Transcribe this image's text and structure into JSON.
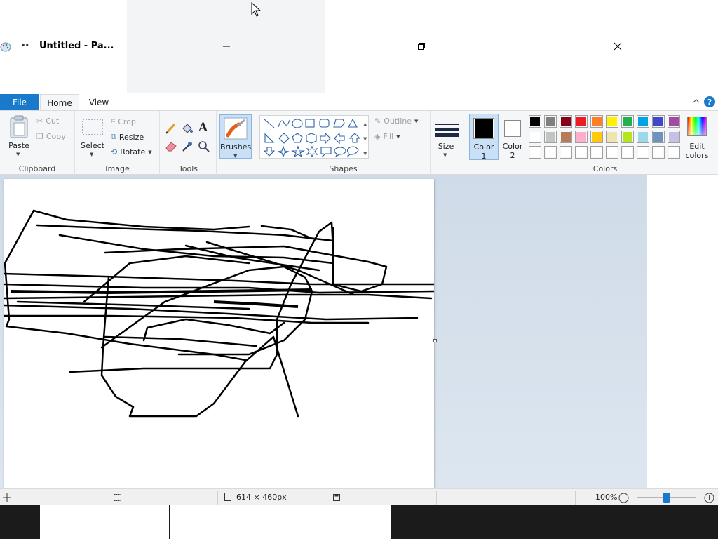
{
  "window": {
    "title": "Untitled - Pa...",
    "quick_access_glyph": "••",
    "controls": [
      "minimize-icon",
      "maximize-icon",
      "close-icon"
    ]
  },
  "ribbon": {
    "tabs": {
      "file": "File",
      "home": "Home",
      "view": "View"
    },
    "clipboard": {
      "label": "Clipboard",
      "paste": "Paste",
      "cut": "Cut",
      "copy": "Copy"
    },
    "image": {
      "label": "Image",
      "select": "Select",
      "crop": "Crop",
      "resize": "Resize",
      "rotate": "Rotate"
    },
    "tools": {
      "label": "Tools",
      "icons": [
        "pencil-icon",
        "fill-bucket-icon",
        "text-icon",
        "eraser-icon",
        "color-picker-icon",
        "magnifier-icon"
      ]
    },
    "brushes": {
      "label": "Brushes"
    },
    "shapes": {
      "label": "Shapes",
      "outline": "Outline",
      "fill": "Fill"
    },
    "size": {
      "label": "Size"
    },
    "color1": {
      "label_line1": "Color",
      "label_line2": "1",
      "value": "#000000"
    },
    "color2": {
      "label_line1": "Color",
      "label_line2": "2",
      "value": "#ffffff"
    },
    "colors": {
      "label": "Colors",
      "edit_line1": "Edit",
      "edit_line2": "colors",
      "row1": [
        "#000000",
        "#7f7f7f",
        "#880015",
        "#ed1c24",
        "#ff7f27",
        "#fff200",
        "#22b14c",
        "#00a2e8",
        "#3f48cc",
        "#a349a4"
      ],
      "row2": [
        "#ffffff",
        "#c3c3c3",
        "#b97a57",
        "#ffaec9",
        "#ffc90e",
        "#efe4b0",
        "#b5e61d",
        "#99d9ea",
        "#7092be",
        "#c8bfe7"
      ],
      "row3": [
        "#ffffff",
        "#ffffff",
        "#ffffff",
        "#ffffff",
        "#ffffff",
        "#ffffff",
        "#ffffff",
        "#ffffff",
        "#ffffff",
        "#ffffff"
      ]
    }
  },
  "statusbar": {
    "canvas_size": "614 × 460px",
    "zoom": "100%",
    "zoom_level_percent": 100
  }
}
